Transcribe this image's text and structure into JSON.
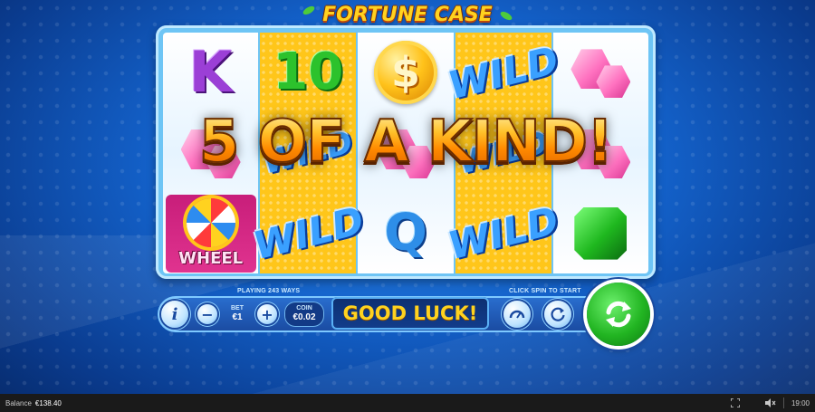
{
  "game": {
    "title": "FORTUNE CASE"
  },
  "reels": [
    {
      "style": "plain",
      "symbols": [
        "K",
        "gem-pink",
        "wheel"
      ]
    },
    {
      "style": "gold",
      "symbols": [
        "10",
        "blank",
        "WILD"
      ]
    },
    {
      "style": "plain",
      "symbols": [
        "$",
        "blank",
        "Q"
      ]
    },
    {
      "style": "gold",
      "symbols": [
        "WILD",
        "blank",
        "WILD"
      ]
    },
    {
      "style": "plain",
      "symbols": [
        "gem-pink",
        "gem-pink",
        "gem-green"
      ]
    }
  ],
  "symbol_text": {
    "k": "K",
    "ten": "10",
    "dollar": "$",
    "wild": "WILD",
    "q": "Q",
    "wheel": "WHEEL"
  },
  "win_banner": "5 OF A KIND!",
  "controls": {
    "info_label": "i",
    "playing_ways": "PLAYING 243 WAYS",
    "bet_label": "BET",
    "bet_value": "€1",
    "minus_label": "−",
    "plus_label": "+",
    "coin_label": "COIN",
    "coin_value": "€0.02",
    "message": "GOOD LUCK!",
    "hint": "CLICK SPIN TO START"
  },
  "status_bar": {
    "balance_label": "Balance",
    "balance_value": "€138.40",
    "clock": "19:00"
  },
  "icons": {
    "info": "info-icon",
    "speed": "speedometer-icon",
    "autoplay": "autoplay-icon",
    "spin": "spin-arrows-icon",
    "fullscreen": "fullscreen-icon",
    "volume": "volume-icon"
  },
  "colors": {
    "background": "#1360c8",
    "reel_gold": "#ffc61a",
    "message_text": "#ffd21f",
    "spin_button": "#22b522",
    "status_bar": "#1a1a1a"
  }
}
